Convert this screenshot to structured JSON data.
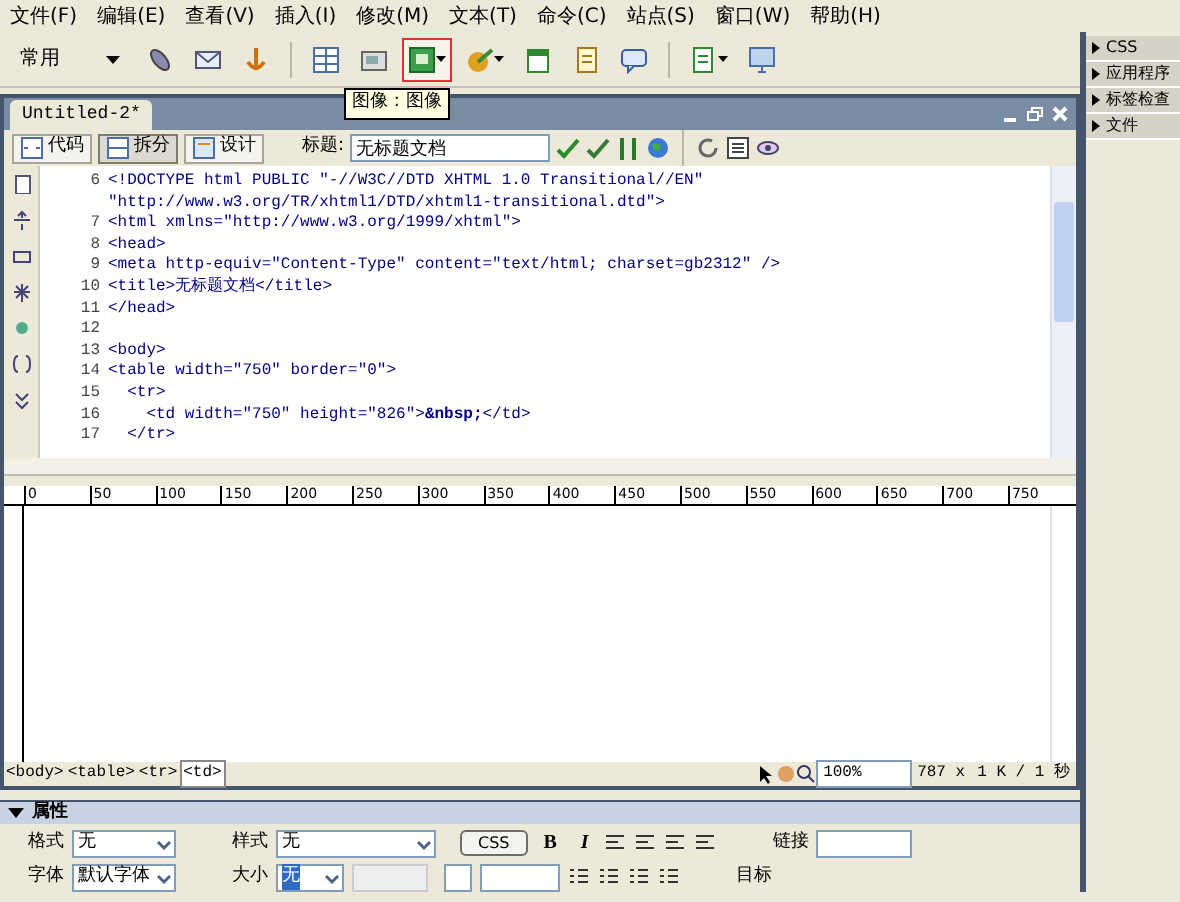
{
  "menu": [
    "文件(F)",
    "编辑(E)",
    "查看(V)",
    "插入(I)",
    "修改(M)",
    "文本(T)",
    "命令(C)",
    "站点(S)",
    "窗口(W)",
    "帮助(H)"
  ],
  "insert_toolbar": {
    "category": "常用",
    "buttons": [
      {
        "kind": "link",
        "hovered": false,
        "dropdown": false
      },
      {
        "kind": "email",
        "hovered": false,
        "dropdown": false
      },
      {
        "kind": "anchor",
        "hovered": false,
        "dropdown": false
      },
      {
        "kind": "sep"
      },
      {
        "kind": "table",
        "hovered": false,
        "dropdown": false
      },
      {
        "kind": "layer",
        "hovered": false,
        "dropdown": false
      },
      {
        "kind": "image",
        "hovered": true,
        "dropdown": true
      },
      {
        "kind": "media",
        "hovered": false,
        "dropdown": true
      },
      {
        "kind": "date",
        "hovered": false,
        "dropdown": false
      },
      {
        "kind": "server",
        "hovered": false,
        "dropdown": false
      },
      {
        "kind": "comment",
        "hovered": false,
        "dropdown": false
      },
      {
        "kind": "sep"
      },
      {
        "kind": "template",
        "hovered": false,
        "dropdown": true
      },
      {
        "kind": "screen",
        "hovered": false,
        "dropdown": false
      }
    ],
    "tooltip": "图像 : 图像"
  },
  "document": {
    "tab": "Untitled-2*",
    "view_buttons": [
      {
        "label": "代码",
        "selected": false
      },
      {
        "label": "拆分",
        "selected": true
      },
      {
        "label": "设计",
        "selected": false
      }
    ],
    "title_label": "标题:",
    "title_value": "无标题文档",
    "code_lines": [
      {
        "number": "6",
        "text": "<!DOCTYPE html PUBLIC \"-//W3C//DTD XHTML 1.0 Transitional//EN\""
      },
      {
        "text": "\"http://www.w3.org/TR/xhtml1/DTD/xhtml1-transitional.dtd\">"
      },
      {
        "number": "7",
        "text": "<html xmlns=\"http://www.w3.org/1999/xhtml\">"
      },
      {
        "number": "8",
        "text": "<head>"
      },
      {
        "number": "9",
        "text": "<meta http-equiv=\"Content-Type\" content=\"text/html; charset=gb2312\" />"
      },
      {
        "number": "10",
        "text": "<title>无标题文档</title>"
      },
      {
        "number": "11",
        "text": "</head>"
      },
      {
        "number": "12"
      },
      {
        "number": "13",
        "text": "<body>"
      },
      {
        "number": "14",
        "text": "<table width=\"750\" border=\"0\">"
      },
      {
        "number": "15",
        "text": "  <tr>"
      },
      {
        "number": "16",
        "text": "    <td width=\"750\" height=\"826\">**&nbsp;**</td>"
      },
      {
        "number": "17",
        "text": "  </tr>"
      }
    ],
    "ruler_labels": [
      "0",
      "50",
      "100",
      "150",
      "200",
      "250",
      "300",
      "350",
      "400",
      "450",
      "500",
      "550",
      "600",
      "650",
      "700",
      "750"
    ],
    "tag_selector": [
      {
        "label": "<body>",
        "selected": false
      },
      {
        "label": "<table>",
        "selected": false
      },
      {
        "label": "<tr>",
        "selected": false
      },
      {
        "label": "<td>",
        "selected": true
      }
    ],
    "status": {
      "zoom": "100%",
      "size": "787 x",
      "download": "1 K / 1 秒"
    }
  },
  "properties": {
    "header": "属性",
    "expanded": true,
    "format_label": "格式",
    "format_value": "无",
    "style_label": "样式",
    "style_value": "无",
    "css_button": "CSS",
    "bold": "B",
    "italic": "I",
    "link_label": "链接",
    "font_label": "字体",
    "font_value": "默认字体",
    "size_label": "大小",
    "size_value": "无",
    "target_label": "目标"
  },
  "panels": [
    {
      "label": "CSS",
      "expanded": false
    },
    {
      "label": "应用程序",
      "expanded": false
    },
    {
      "label": "标签检查",
      "expanded": false
    },
    {
      "label": "文件",
      "expanded": false
    }
  ]
}
